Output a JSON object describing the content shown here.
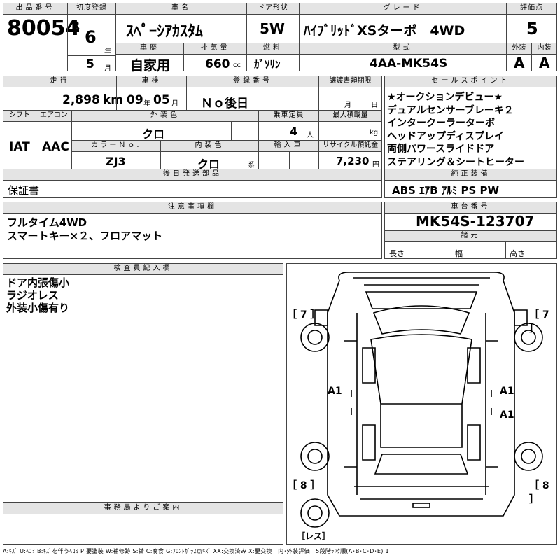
{
  "header": {
    "lot_label": "出品番号",
    "lot_no": "80054",
    "first_reg_label": "初度登録",
    "era": "R",
    "year": "6",
    "year_unit": "年",
    "month": "5",
    "month_unit": "月",
    "car_name_label": "車名",
    "car_name": "ｽﾍﾟｰｼｱｶｽﾀﾑ",
    "door_label": "ドア形状",
    "door": "5W",
    "grade_label": "グレード",
    "grade": "ﾊｲﾌﾞﾘｯﾄﾞXSターボ　4WD",
    "score_label": "評価点",
    "score": "5",
    "history_label": "車歴",
    "history": "自家用",
    "displacement_label": "排気量",
    "displacement": "660",
    "displacement_unit": "cc",
    "fuel_label": "燃料",
    "fuel": "ｶﾞｿﾘﾝ",
    "model_label": "型式",
    "model": "4AA-MK54S",
    "ext_label": "外装",
    "ext": "A",
    "int_label": "内装",
    "int": "A"
  },
  "row2": {
    "mileage_label": "走行",
    "mileage": "2,898",
    "mileage_unit": "km",
    "inspection_label": "車検",
    "insp_year": "09",
    "insp_year_unit": "年",
    "insp_month": "05",
    "insp_month_unit": "月",
    "registration_label": "登録番号",
    "registration": "Ｎｏ後日",
    "transfer_label": "譲渡書類期限",
    "transfer_month": "月",
    "transfer_day": "日",
    "shift_label": "シフト",
    "shift": "IAT",
    "ac_label": "エアコン",
    "ac": "AAC",
    "exterior_color_label": "外装色",
    "exterior_color": "クロ",
    "capacity_label": "乗車定員",
    "capacity": "4",
    "capacity_unit": "人",
    "max_load_label": "最大積載量",
    "max_load_unit": "kg",
    "color_no_label": "カラーＮｏ.",
    "color_no": "ZJ3",
    "interior_color_label": "内装色",
    "interior_color": "クロ",
    "interior_color_unit": "系",
    "import_label": "輸入車",
    "recycle_label": "リサイクル預託金",
    "recycle": "7,230",
    "recycle_unit": "円",
    "later_parts_label": "後日発送部品",
    "later_parts": "保証書"
  },
  "sales_points": {
    "label": "セールスポイント",
    "items": [
      "★オークションデビュー★",
      "デュアルセンサーブレーキ２",
      "インタークーラーターボ",
      "ヘッドアップディスプレイ",
      "両側パワースライドドア",
      "ステアリング＆シートヒーター"
    ]
  },
  "equipment": {
    "label": "純正装備",
    "value": "ABS ｴｱB ｱﾙﾐ PS PW"
  },
  "notes": {
    "label": "注意事項欄",
    "lines": [
      "フルタイム4WD",
      "スマートキー×２、フロアマット"
    ]
  },
  "chassis": {
    "label": "車台番号",
    "value": "MK54S-123707"
  },
  "specs": {
    "label": "諸元",
    "length": "長さ",
    "width": "幅",
    "height": "高さ"
  },
  "inspector": {
    "label": "検査員記入欄",
    "lines": [
      "ドア内張傷小",
      "ラジオレス",
      "外装小傷有り"
    ]
  },
  "office": {
    "label": "事務局よりご案内"
  },
  "diagram": {
    "tl": "［ 7 ］",
    "tr": "［ 7 ］",
    "bl": "［ 8 ］",
    "br": "［ 8 ］",
    "m1": "A1",
    "m2": "A1",
    "m3": "A1",
    "radio": "［レス］"
  },
  "legend": "A:ｷｽﾞ U:ﾍｺﾐ B:ｷｽﾞを伴うﾍｺﾐ P:要塗装 W:補修跡 S:錆 C:腐食 G:ﾌﾛﾝﾄｶﾞﾗｽ点ｷｽﾞ XX:交換済み X:要交換　内･外装評価　5段階ﾗﾝｸ順(A･B･C･D･E) 1"
}
